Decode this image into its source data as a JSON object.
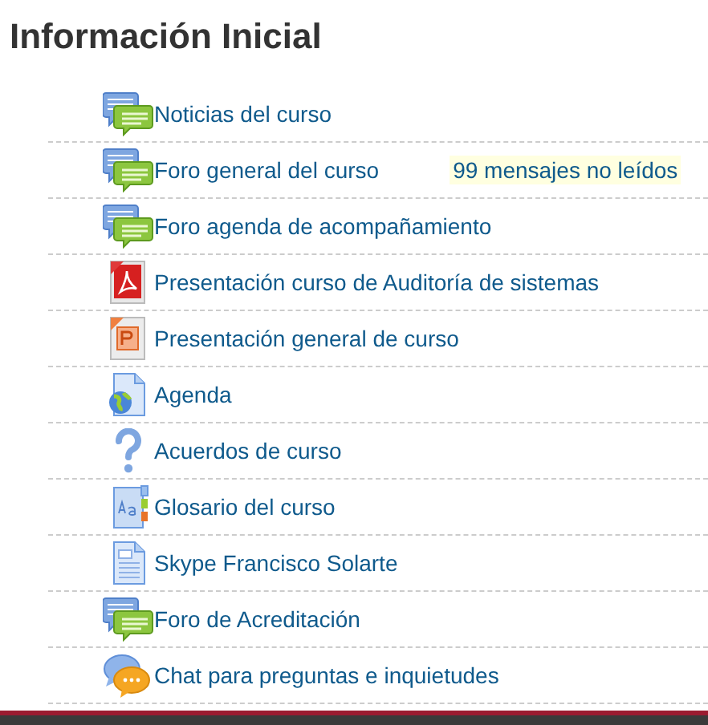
{
  "section": {
    "title": "Información Inicial"
  },
  "activities": [
    {
      "kind": "forum",
      "name": "Noticias del curso"
    },
    {
      "kind": "forum",
      "name": "Foro general del curso",
      "unread": "99 mensajes no leídos"
    },
    {
      "kind": "forum",
      "name": "Foro agenda de acompañamiento"
    },
    {
      "kind": "pdf",
      "name": "Presentación curso de Auditoría de sistemas"
    },
    {
      "kind": "slides",
      "name": "Presentación general de curso"
    },
    {
      "kind": "url",
      "name": "Agenda"
    },
    {
      "kind": "question",
      "name": "Acuerdos de curso"
    },
    {
      "kind": "glossary",
      "name": "Glosario del curso"
    },
    {
      "kind": "page",
      "name": "Skype Francisco Solarte"
    },
    {
      "kind": "forum",
      "name": "Foro de Acreditación"
    },
    {
      "kind": "chat",
      "name": "Chat para preguntas e inquietudes"
    }
  ]
}
